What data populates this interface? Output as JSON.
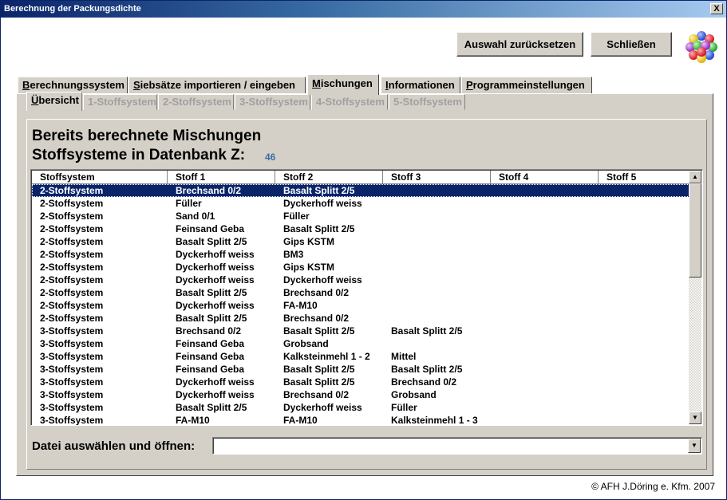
{
  "window": {
    "title": "Berechnung der Packungsdichte",
    "close_label": "X"
  },
  "toolbar": {
    "reset_label": "Auswahl zurücksetzen",
    "close_label": "Schließen"
  },
  "tabs": [
    {
      "first": "B",
      "rest": "erechnungssystem"
    },
    {
      "first": "S",
      "rest": "iebsätze importieren / eingeben"
    },
    {
      "first": "M",
      "rest": "ischungen"
    },
    {
      "first": "I",
      "rest": "nformationen"
    },
    {
      "first": "P",
      "rest": "rogrammeinstellungen"
    }
  ],
  "subtabs": [
    {
      "first": "Ü",
      "rest": "bersicht"
    },
    {
      "label": "1-Stoffsystem"
    },
    {
      "label": "2-Stoffsystem"
    },
    {
      "label": "3-Stoffsystem"
    },
    {
      "label": "4-Stoffsystem"
    },
    {
      "label": "5-Stoffsystem"
    }
  ],
  "overview": {
    "heading1": "Bereits berechnete Mischungen",
    "heading2": "Stoffsysteme in Datenbank Z:",
    "count": "46"
  },
  "table": {
    "columns": [
      "Stoffsystem",
      "Stoff 1",
      "Stoff 2",
      "Stoff 3",
      "Stoff 4",
      "Stoff 5"
    ],
    "rows": [
      [
        "2-Stoffsystem",
        "Brechsand 0/2",
        "Basalt Splitt 2/5",
        "",
        "",
        ""
      ],
      [
        "2-Stoffsystem",
        "Füller",
        "Dyckerhoff weiss",
        "",
        "",
        ""
      ],
      [
        "2-Stoffsystem",
        "Sand 0/1",
        "Füller",
        "",
        "",
        ""
      ],
      [
        "2-Stoffsystem",
        "Feinsand Geba",
        "Basalt Splitt 2/5",
        "",
        "",
        ""
      ],
      [
        "2-Stoffsystem",
        "Basalt Splitt 2/5",
        "Gips KSTM",
        "",
        "",
        ""
      ],
      [
        "2-Stoffsystem",
        "Dyckerhoff weiss",
        "BM3",
        "",
        "",
        ""
      ],
      [
        "2-Stoffsystem",
        "Dyckerhoff weiss",
        "Gips KSTM",
        "",
        "",
        ""
      ],
      [
        "2-Stoffsystem",
        "Dyckerhoff weiss",
        "Dyckerhoff weiss",
        "",
        "",
        ""
      ],
      [
        "2-Stoffsystem",
        "Basalt Splitt 2/5",
        "Brechsand 0/2",
        "",
        "",
        ""
      ],
      [
        "2-Stoffsystem",
        "Dyckerhoff weiss",
        "FA-M10",
        "",
        "",
        ""
      ],
      [
        "2-Stoffsystem",
        "Basalt Splitt 2/5",
        "Brechsand 0/2",
        "",
        "",
        ""
      ],
      [
        "3-Stoffsystem",
        "Brechsand 0/2",
        "Basalt Splitt 2/5",
        "Basalt Splitt 2/5",
        "",
        ""
      ],
      [
        "3-Stoffsystem",
        "Feinsand Geba",
        "Grobsand",
        "",
        "",
        ""
      ],
      [
        "3-Stoffsystem",
        "Feinsand Geba",
        "Kalksteinmehl 1 - 2",
        "Mittel",
        "",
        ""
      ],
      [
        "3-Stoffsystem",
        "Feinsand Geba",
        "Basalt Splitt 2/5",
        "Basalt Splitt 2/5",
        "",
        ""
      ],
      [
        "3-Stoffsystem",
        "Dyckerhoff weiss",
        "Basalt Splitt 2/5",
        "Brechsand 0/2",
        "",
        ""
      ],
      [
        "3-Stoffsystem",
        "Dyckerhoff weiss",
        "Brechsand 0/2",
        "Grobsand",
        "",
        ""
      ],
      [
        "3-Stoffsystem",
        "Basalt Splitt 2/5",
        "Dyckerhoff weiss",
        "Füller",
        "",
        ""
      ],
      [
        "3-Stoffsystem",
        "FA-M10",
        "FA-M10",
        "Kalksteinmehl 1 - 3",
        "",
        ""
      ]
    ],
    "selected_row": 0
  },
  "file_open": {
    "label": "Datei auswählen und öffnen:",
    "value": ""
  },
  "footer": {
    "copyright": "© AFH J.Döring e. Kfm. 2007"
  },
  "icons": {
    "logo": "molecule-spheres-icon",
    "scroll_up": "arrow-up-icon",
    "scroll_down": "arrow-down-icon",
    "combo_dropdown": "arrow-down-icon"
  },
  "colors": {
    "selection": "#0a246a",
    "count_text": "#3a6ea5",
    "face": "#d4d0c8"
  }
}
